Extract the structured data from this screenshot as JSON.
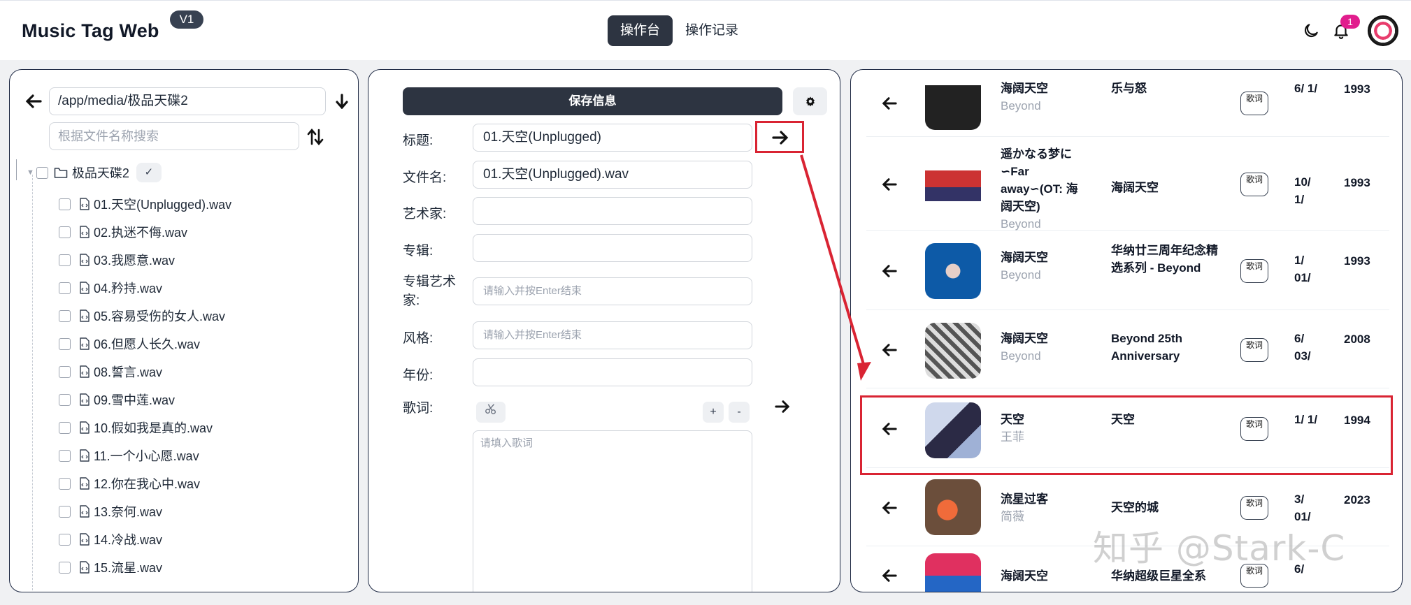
{
  "header": {
    "app_title": "Music Tag Web",
    "version": "V1",
    "tabs": [
      {
        "label": "操作台",
        "active": true
      },
      {
        "label": "操作记录",
        "active": false
      }
    ],
    "notification_count": "1",
    "icons": {
      "theme": "moon-icon",
      "notifications": "bell-icon",
      "user": "avatar"
    }
  },
  "file_browser": {
    "path": "/app/media/极品天碟2",
    "search_placeholder": "根据文件名称搜索",
    "folder_name": "极品天碟2",
    "files": [
      "01.天空(Unplugged).wav",
      "02.执迷不侮.wav",
      "03.我愿意.wav",
      "04.矜持.wav",
      "05.容易受伤的女人.wav",
      "06.但愿人长久.wav",
      "08.誓言.wav",
      "09.雪中莲.wav",
      "10.假如我是真的.wav",
      "11.一个小心愿.wav",
      "12.你在我心中.wav",
      "13.奈何.wav",
      "14.冷战.wav",
      "15.流星.wav"
    ]
  },
  "editor": {
    "save_label": "保存信息",
    "fields": {
      "title_label": "标题:",
      "title_value": "01.天空(Unplugged)",
      "filename_label": "文件名:",
      "filename_value": "01.天空(Unplugged).wav",
      "artist_label": "艺术家:",
      "artist_value": "",
      "album_label": "专辑:",
      "album_value": "",
      "album_artist_label": "专辑艺术家:",
      "album_artist_placeholder": "请输入并按Enter结束",
      "genre_label": "风格:",
      "genre_placeholder": "请输入并按Enter结束",
      "year_label": "年份:",
      "year_value": "",
      "lyrics_label": "歌词:",
      "lyrics_placeholder": "请填入歌词"
    },
    "lyric_plus": "+",
    "lyric_minus": "-"
  },
  "results": {
    "lyric_badge": "歌词",
    "songs": [
      {
        "title": "海阔天空",
        "artist": "Beyond",
        "album": "乐与怒",
        "date": "6/ 1/",
        "year": "1993"
      },
      {
        "title": "遥かなる梦に∽Far away∽(OT: 海阔天空)",
        "artist": "Beyond",
        "album": "海阔天空",
        "date": "10/ 1/",
        "year": "1993"
      },
      {
        "title": "海阔天空",
        "artist": "Beyond",
        "album": "华纳廿三周年纪念精选系列 - Beyond",
        "date": "1/ 01/",
        "year": "1993"
      },
      {
        "title": "海阔天空",
        "artist": "Beyond",
        "album": "Beyond 25th Anniversary",
        "date": "6/ 03/",
        "year": "2008"
      },
      {
        "title": "天空",
        "artist": "王菲",
        "album": "天空",
        "date": "1/ 1/",
        "year": "1994"
      },
      {
        "title": "流星过客",
        "artist": "简薇",
        "album": "天空的城",
        "date": "3/ 01/",
        "year": "2023"
      },
      {
        "title": "海阔天空",
        "artist": "",
        "album": "华纳超级巨星全系",
        "date": "6/",
        "year": ""
      }
    ]
  },
  "watermark": "知乎 @Stark-C",
  "colors": {
    "accent_dark": "#2d3441",
    "highlight_red": "#d92433",
    "badge_pink": "#e11d8d"
  }
}
